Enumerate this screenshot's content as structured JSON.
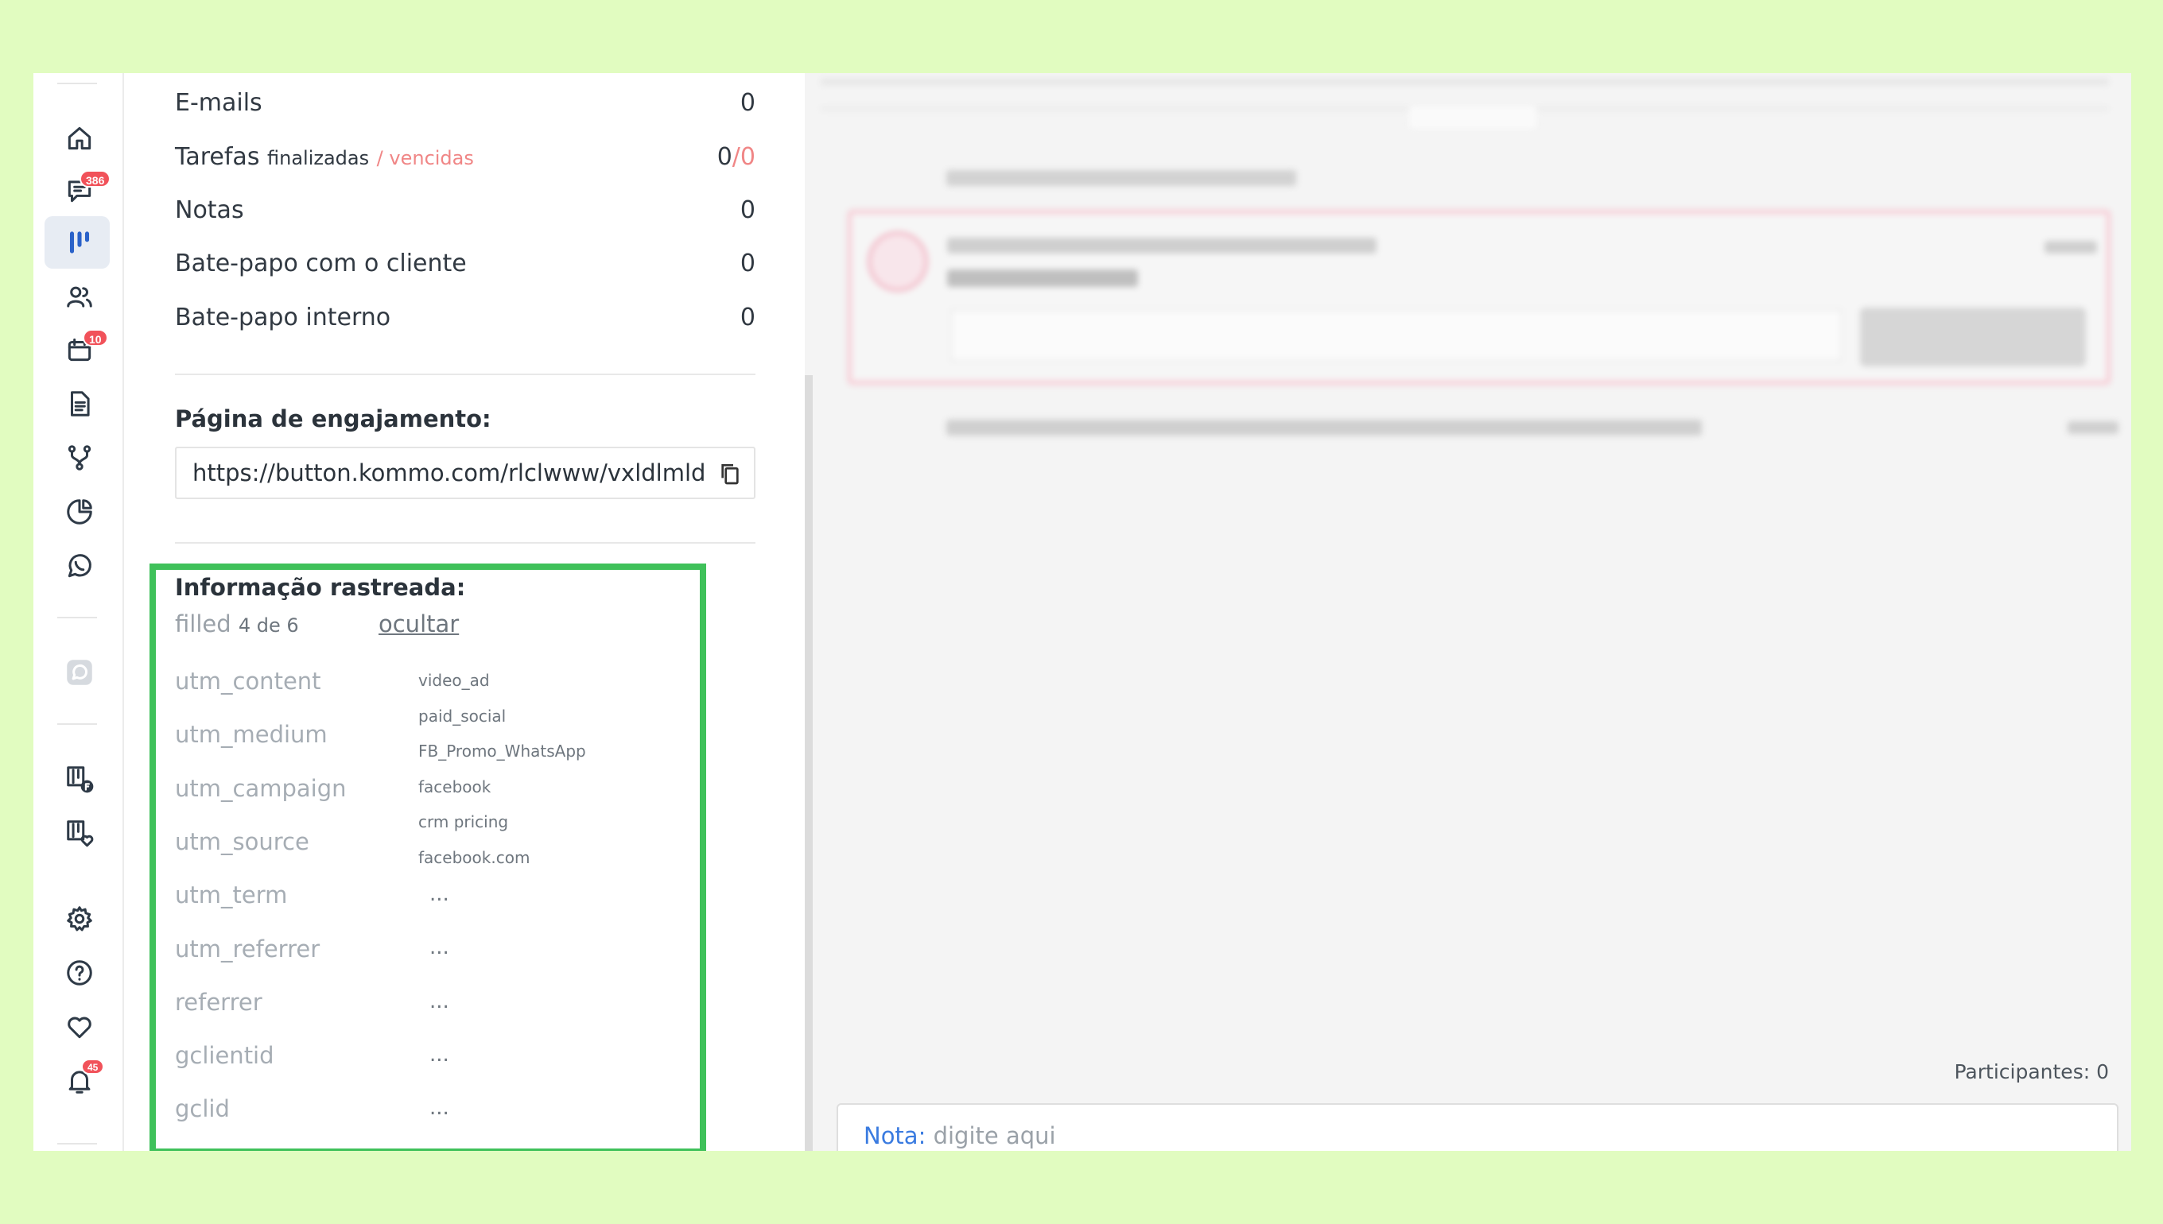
{
  "sidebar": {
    "badges": {
      "chats": "386",
      "calendar": "10",
      "notifications": "45"
    }
  },
  "stats": {
    "emails_label": "E-mails",
    "emails_value": "0",
    "tasks_label": "Tarefas",
    "tasks_finished": "finalizadas",
    "tasks_overdue": "/ vencidas",
    "tasks_value_done": "0",
    "tasks_value_sep": "/",
    "tasks_value_overdue": "0",
    "notes_label": "Notas",
    "notes_value": "0",
    "client_chat_label": "Bate-papo com o cliente",
    "client_chat_value": "0",
    "internal_chat_label": "Bate-papo interno",
    "internal_chat_value": "0"
  },
  "engagement": {
    "title": "Página de engajamento:",
    "url": "https://button.kommo.com/rlclwww/vxldlmld"
  },
  "tracked": {
    "title": "Informação rastreada:",
    "filled_label": "filled",
    "filled_count": "4 de 6",
    "hide_link": "ocultar",
    "keys": [
      "utm_content",
      "utm_medium",
      "utm_campaign",
      "utm_source",
      "utm_term",
      "utm_referrer",
      "referrer",
      "gclientid",
      "gclid"
    ],
    "values": [
      "video_ad",
      "paid_social",
      "FB_Promo_WhatsApp",
      "facebook",
      "crm pricing",
      "facebook.com"
    ],
    "empty_values": [
      "...",
      "...",
      "...",
      "...",
      "..."
    ]
  },
  "feed": {
    "participants": "Participantes: 0",
    "note_label": "Nota:",
    "note_placeholder": "digite aqui"
  },
  "colors": {
    "frame": "#3fc15a",
    "accent_red": "#f08686",
    "link_blue": "#3a7be0"
  }
}
